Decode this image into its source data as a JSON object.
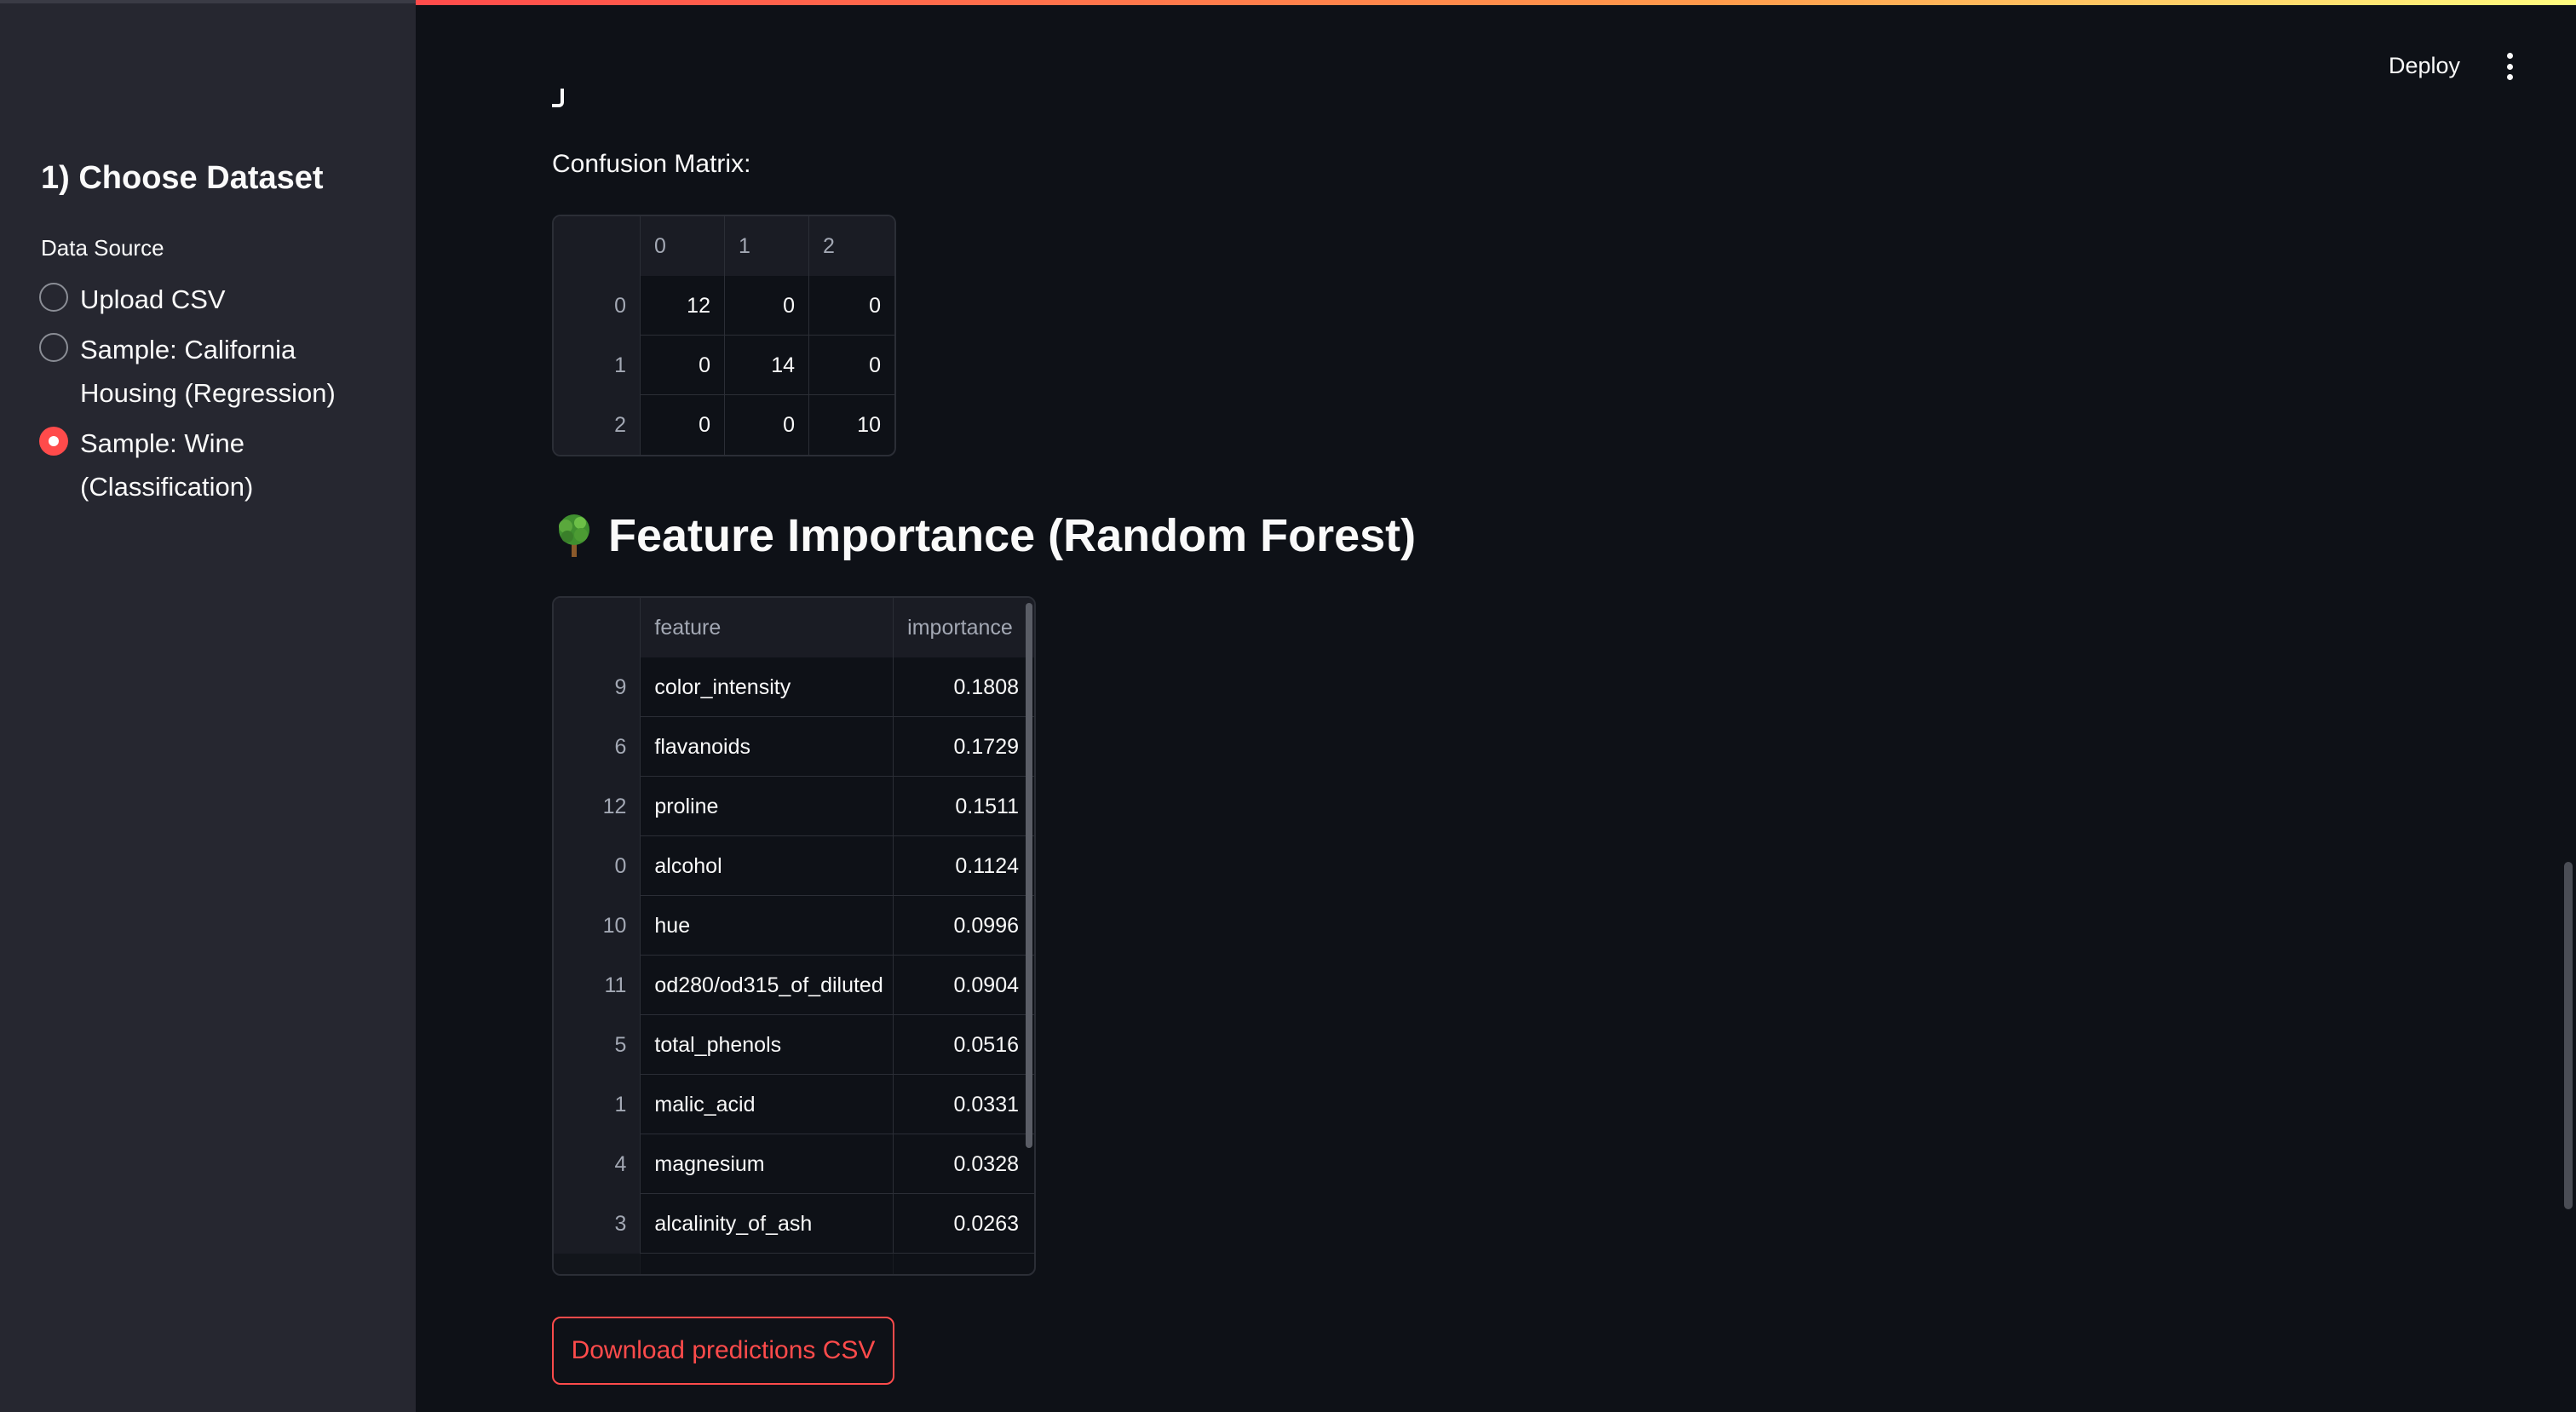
{
  "header": {
    "deploy_label": "Deploy",
    "menu_icon": "vertical-ellipsis-icon"
  },
  "sidebar": {
    "title": "1) Choose Dataset",
    "radio_label": "Data Source",
    "options": [
      {
        "label": "Upload CSV",
        "selected": false
      },
      {
        "label": "Sample: California Housing (Regression)",
        "selected": false
      },
      {
        "label": "Sample: Wine (Classification)",
        "selected": true
      }
    ]
  },
  "main": {
    "confusion_matrix_label": "Confusion Matrix:",
    "confusion_matrix": {
      "columns": [
        "",
        "0",
        "1",
        "2"
      ],
      "rows": [
        [
          "0",
          "12",
          "0",
          "0"
        ],
        [
          "1",
          "0",
          "14",
          "0"
        ],
        [
          "2",
          "0",
          "0",
          "10"
        ]
      ]
    },
    "feature_importance_title": "Feature Importance (Random Forest)",
    "feature_importance_icon": "tree-icon",
    "feature_table": {
      "columns": [
        "",
        "feature",
        "importance"
      ],
      "rows": [
        [
          "9",
          "color_intensity",
          "0.1808"
        ],
        [
          "6",
          "flavanoids",
          "0.1729"
        ],
        [
          "12",
          "proline",
          "0.1511"
        ],
        [
          "0",
          "alcohol",
          "0.1124"
        ],
        [
          "10",
          "hue",
          "0.0996"
        ],
        [
          "11",
          "od280/od315_of_diluted",
          "0.0904"
        ],
        [
          "5",
          "total_phenols",
          "0.0516"
        ],
        [
          "1",
          "malic_acid",
          "0.0331"
        ],
        [
          "4",
          "magnesium",
          "0.0328"
        ],
        [
          "3",
          "alcalinity_of_ash",
          "0.0263"
        ]
      ]
    },
    "download_label": "Download predictions CSV"
  },
  "colors": {
    "accent": "#ff4b4b",
    "background": "#0e1117",
    "sidebar": "#262730"
  }
}
